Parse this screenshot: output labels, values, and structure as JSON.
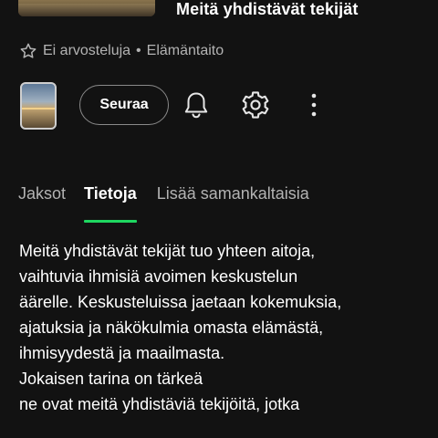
{
  "header": {
    "title": "Meitä yhdistävät tekijät"
  },
  "meta": {
    "rating_icon": "star-outline-icon",
    "rating_text": "Ei arvosteluja",
    "separator": "•",
    "category": "Elämäntaito"
  },
  "actions": {
    "follow_label": "Seuraa",
    "bell_icon": "bell-icon",
    "settings_icon": "gear-icon",
    "more_icon": "more-vertical-icon"
  },
  "tabs": [
    {
      "label": "Jaksot",
      "active": false
    },
    {
      "label": "Tietoja",
      "active": true
    },
    {
      "label": "Lisää samankaltaisia",
      "active": false
    }
  ],
  "description": {
    "lines": [
      "Meitä yhdistävät tekijät tuo yhteen aitoja,",
      "vaihtuvia ihmisiä avoimen keskustelun",
      "äärelle. Keskusteluissa jaetaan kokemuksia,",
      "ajatuksia ja näkökulmia omasta elämästä,",
      "ihmisyydestä ja maailmasta.",
      "Jokaisen tarina on tärkeä",
      "ne ovat meitä yhdistäviä tekijöitä, jotka"
    ]
  },
  "colors": {
    "background": "#121212",
    "accent": "#1ed760",
    "secondary_text": "#b3b3b3"
  }
}
